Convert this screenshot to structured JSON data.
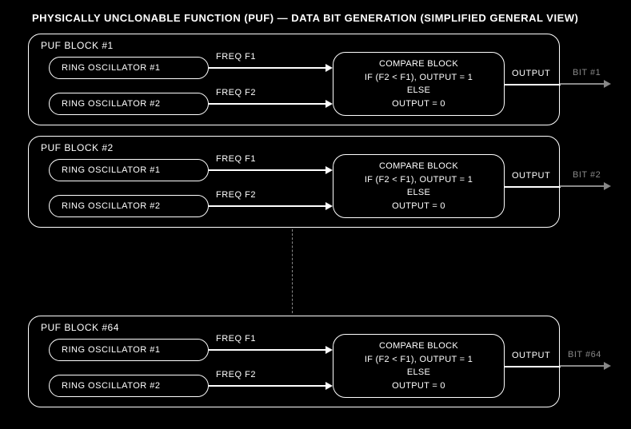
{
  "title": "PHYSICALLY UNCLONABLE FUNCTION (PUF) — DATA BIT GENERATION (SIMPLIFIED GENERAL VIEW)",
  "blocks": [
    {
      "label": "PUF BLOCK #1",
      "ring1": "RING OSCILLATOR #1",
      "ring2": "RING OSCILLATOR #2",
      "freq1": "FREQ F1",
      "freq2": "FREQ F2",
      "compare_l1": "COMPARE BLOCK",
      "compare_l2": "IF (F2 < F1), OUTPUT = 1",
      "compare_l3": "ELSE",
      "compare_l4": "OUTPUT = 0",
      "output": "OUTPUT",
      "bit": "BIT #1"
    },
    {
      "label": "PUF BLOCK #2",
      "ring1": "RING OSCILLATOR #1",
      "ring2": "RING OSCILLATOR #2",
      "freq1": "FREQ F1",
      "freq2": "FREQ F2",
      "compare_l1": "COMPARE BLOCK",
      "compare_l2": "IF (F2 < F1), OUTPUT = 1",
      "compare_l3": "ELSE",
      "compare_l4": "OUTPUT = 0",
      "output": "OUTPUT",
      "bit": "BIT #2"
    },
    {
      "label": "PUF BLOCK #64",
      "ring1": "RING OSCILLATOR #1",
      "ring2": "RING OSCILLATOR #2",
      "freq1": "FREQ F1",
      "freq2": "FREQ F2",
      "compare_l1": "COMPARE BLOCK",
      "compare_l2": "IF (F2 < F1), OUTPUT = 1",
      "compare_l3": "ELSE",
      "compare_l4": "OUTPUT = 0",
      "output": "OUTPUT",
      "bit": "BIT #64"
    }
  ]
}
